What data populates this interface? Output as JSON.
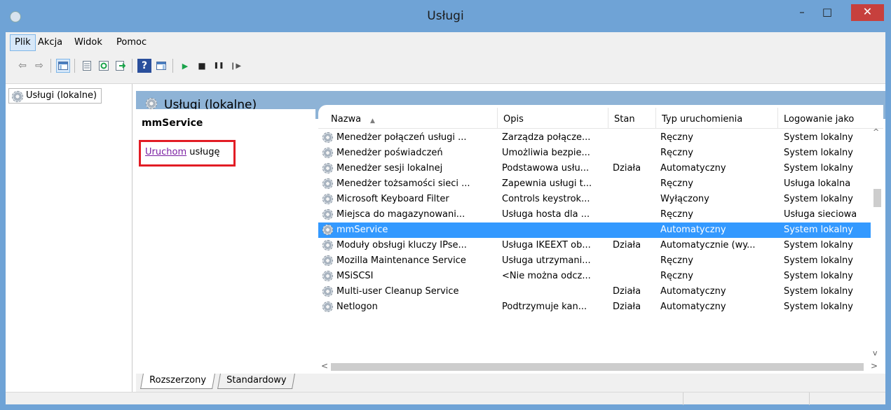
{
  "window": {
    "title": "Usługi",
    "minimize": "–",
    "maximize": "□",
    "close": "✕"
  },
  "menu": [
    "Plik",
    "Akcja",
    "Widok",
    "Pomoc"
  ],
  "toolbar": {
    "back_icon": "⇦",
    "forward_icon": "⇨",
    "help_icon": "?",
    "start_icon": "▶",
    "stop_icon": "■",
    "pause_icon": "❚❚",
    "resume_icon": "❙▶"
  },
  "tree": {
    "item": "Usługi (lokalne)"
  },
  "main": {
    "header": "Usługi (lokalne)",
    "selected_service": "mmService",
    "start_link": "Uruchom",
    "start_suffix": " usługę"
  },
  "table": {
    "columns": [
      "Nazwa",
      "Opis",
      "Stan",
      "Typ uruchomienia",
      "Logowanie jako"
    ],
    "rows": [
      {
        "name": "Menedżer połączeń usługi ...",
        "opis": "Zarządza połącze...",
        "stan": "",
        "typ": "Ręczny",
        "log": "System lokalny"
      },
      {
        "name": "Menedżer poświadczeń",
        "opis": "Umożliwia bezpie...",
        "stan": "",
        "typ": "Ręczny",
        "log": "System lokalny"
      },
      {
        "name": "Menedżer sesji lokalnej",
        "opis": "Podstawowa usłu...",
        "stan": "Działa",
        "typ": "Automatyczny",
        "log": "System lokalny"
      },
      {
        "name": "Menedżer tożsamości sieci ...",
        "opis": "Zapewnia usługi t...",
        "stan": "",
        "typ": "Ręczny",
        "log": "Usługa lokalna"
      },
      {
        "name": "Microsoft Keyboard Filter",
        "opis": "Controls keystrok...",
        "stan": "",
        "typ": "Wyłączony",
        "log": "System lokalny"
      },
      {
        "name": "Miejsca do magazynowani...",
        "opis": "Usługa hosta dla ...",
        "stan": "",
        "typ": "Ręczny",
        "log": "Usługa sieciowa"
      },
      {
        "name": "mmService",
        "opis": "",
        "stan": "",
        "typ": "Automatyczny",
        "log": "System lokalny"
      },
      {
        "name": "Moduły obsługi kluczy IPse...",
        "opis": "Usługa IKEEXT ob...",
        "stan": "Działa",
        "typ": "Automatycznie (wy...",
        "log": "System lokalny"
      },
      {
        "name": "Mozilla Maintenance Service",
        "opis": "Usługa utrzymani...",
        "stan": "",
        "typ": "Ręczny",
        "log": "System lokalny"
      },
      {
        "name": "MSiSCSI",
        "opis": "<Nie można odcz...",
        "stan": "",
        "typ": "Ręczny",
        "log": "System lokalny"
      },
      {
        "name": "Multi-user Cleanup Service",
        "opis": "",
        "stan": "Działa",
        "typ": "Automatyczny",
        "log": "System lokalny"
      },
      {
        "name": "Netlogon",
        "opis": "Podtrzymuje kan...",
        "stan": "Działa",
        "typ": "Automatyczny",
        "log": "System lokalny"
      }
    ]
  },
  "tabs": [
    "Rozszerzony",
    "Standardowy"
  ],
  "colors": {
    "titlebar": "#6fa3d6",
    "selection": "#3399ff",
    "highlight_box": "#e21d25",
    "close_button": "#c7403d"
  }
}
